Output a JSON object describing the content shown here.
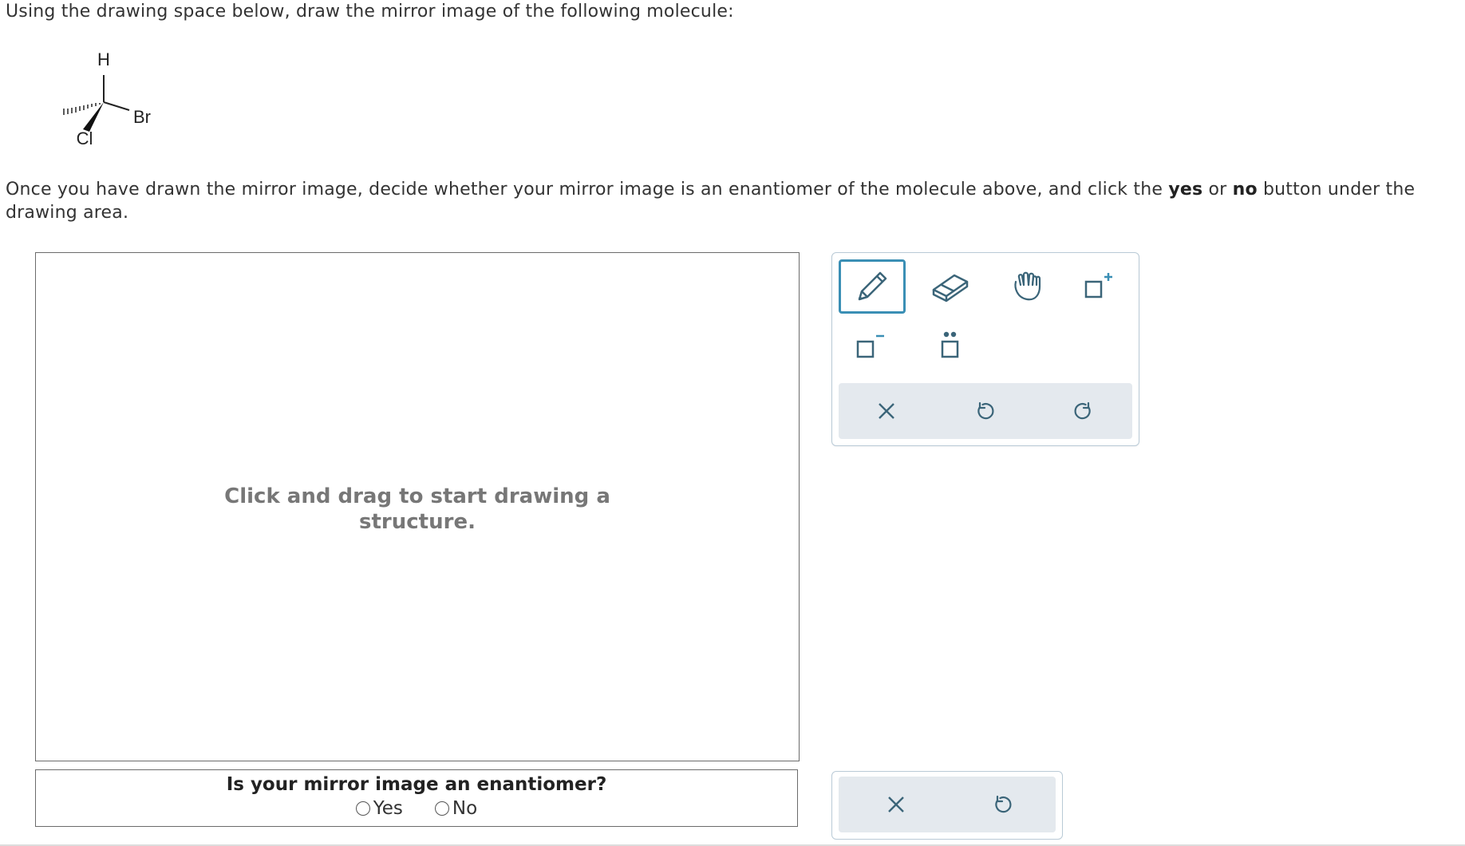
{
  "question": {
    "instruction": "Using the drawing space below, draw the mirror image of the following molecule:",
    "followup": {
      "text1": "Once you have drawn the mirror image, decide whether your mirror image is an enantiomer of the molecule above, and click the ",
      "yes_word": "yes",
      "text2": " or ",
      "no_word": "no",
      "text3": " button under the drawing area."
    }
  },
  "molecule": {
    "atoms": {
      "top": "H",
      "right": "Br",
      "bottom": "Cl"
    }
  },
  "canvas": {
    "placeholder_line1": "Click and drag to start drawing a",
    "placeholder_line2": "structure."
  },
  "toolbar": {
    "tools": [
      "pencil-icon",
      "eraser-icon",
      "hand-icon",
      "add-positive-charge-icon",
      "add-negative-charge-icon",
      "add-lone-pair-icon"
    ],
    "actions": [
      "clear-icon",
      "undo-icon",
      "redo-icon"
    ],
    "selected_tool": "pencil-icon",
    "accent": "#3a8fb5",
    "icon_color": "#3b6579",
    "bar_color": "#e4e9ee"
  },
  "answer": {
    "question": "Is your mirror image an enantiomer?",
    "yes_label": "Yes",
    "no_label": "No"
  },
  "bottom_actions": [
    "clear-icon",
    "undo-icon"
  ]
}
